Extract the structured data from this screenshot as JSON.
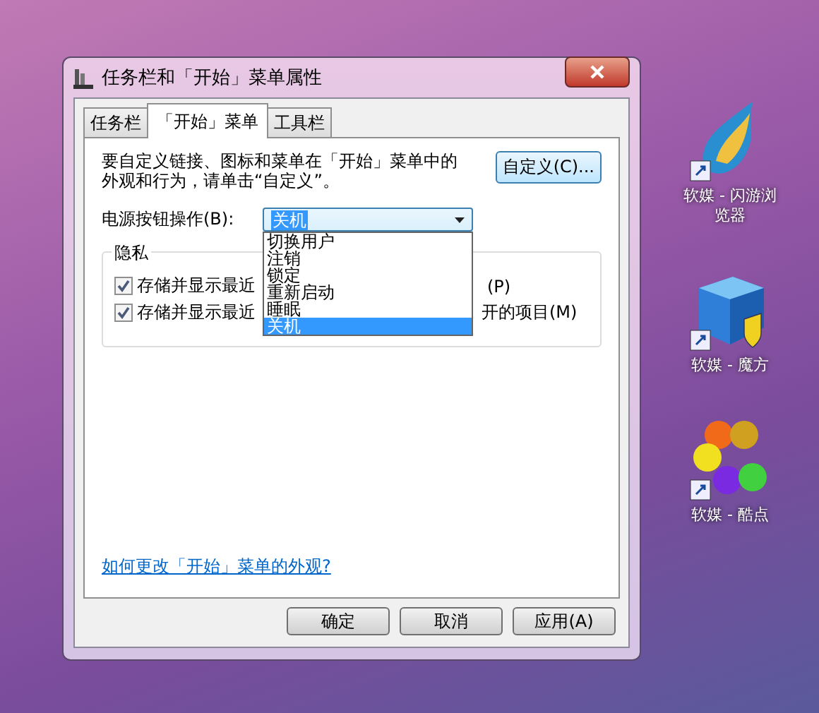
{
  "window": {
    "title": "任务栏和「开始」菜单属性"
  },
  "tabs": [
    {
      "label": "任务栏",
      "selected": false
    },
    {
      "label": "「开始」菜单",
      "selected": true
    },
    {
      "label": "工具栏",
      "selected": false
    }
  ],
  "description": "要自定义链接、图标和菜单在「开始」菜单中的外观和行为，请单击“自定义”。",
  "customize_button": "自定义(C)...",
  "power_label": "电源按钮操作(B):",
  "power_dropdown": {
    "value": "关机",
    "expanded": true,
    "options": [
      {
        "label": "切换用户",
        "selected": false
      },
      {
        "label": "注销",
        "selected": false
      },
      {
        "label": "锁定",
        "selected": false
      },
      {
        "label": "重新启动",
        "selected": false
      },
      {
        "label": "睡眠",
        "selected": false
      },
      {
        "label": "关机",
        "selected": true
      }
    ]
  },
  "privacy": {
    "title": "隐私",
    "checkboxes": [
      {
        "label_start": "存储并显示最近",
        "label_end": "(P)",
        "checked": true
      },
      {
        "label_start": "存储并显示最近",
        "label_end": "开的项目(M)",
        "checked": true
      }
    ]
  },
  "help_link": "如何更改「开始」菜单的外观?",
  "buttons": [
    "确定",
    "取消",
    "应用(A)"
  ],
  "desktop_icons": [
    {
      "kind": "browser",
      "label": "软媒 - 闪游浏览器"
    },
    {
      "kind": "cube",
      "label": "软媒 - 魔方"
    },
    {
      "kind": "hexagons",
      "label": "软媒 - 酷点"
    }
  ]
}
